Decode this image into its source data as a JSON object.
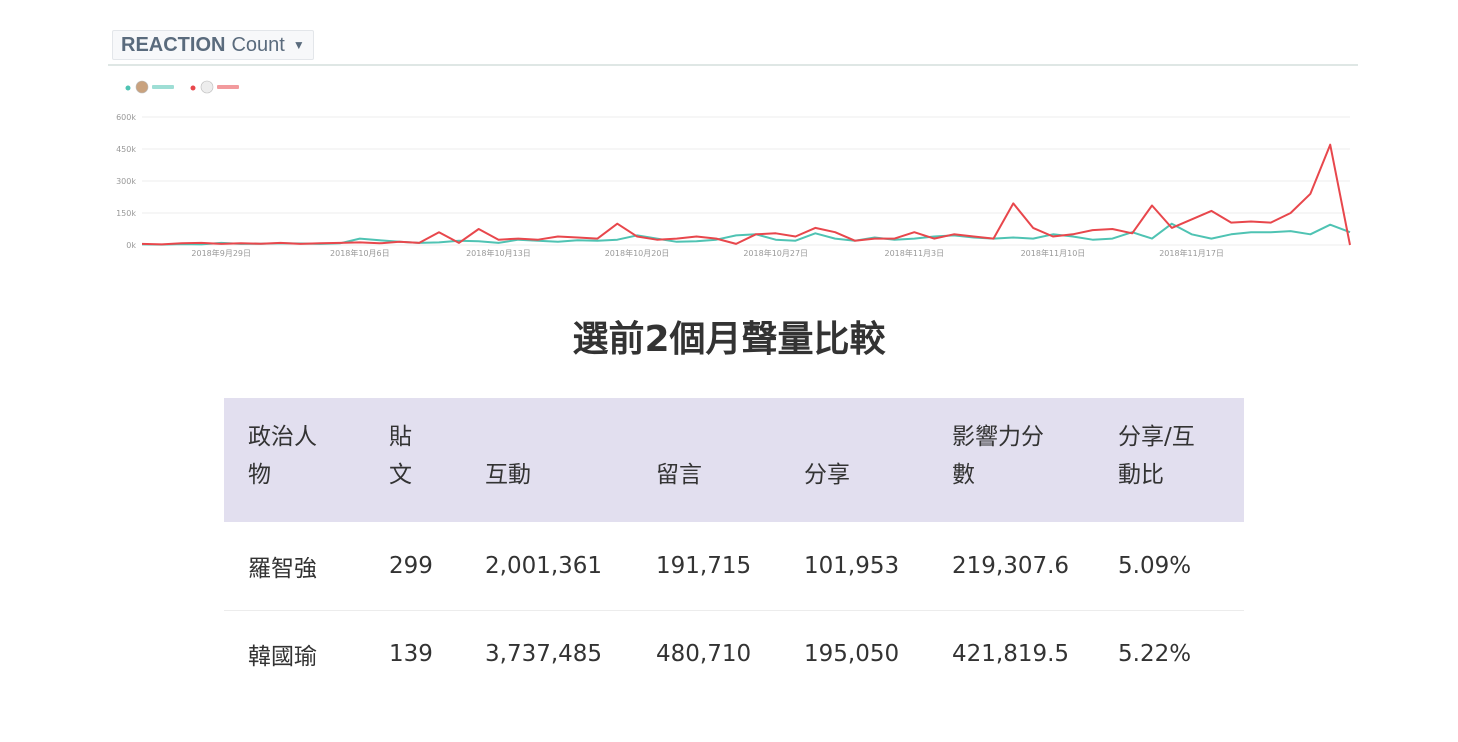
{
  "dropdown": {
    "bold": "REACTION",
    "rest": "Count",
    "caret_icon": "caret-down-icon"
  },
  "colors": {
    "series_1": "#4fc3b3",
    "series_2": "#e8474c",
    "grid": "#eeeeee",
    "axis_text": "#999999"
  },
  "chart_data": {
    "type": "line",
    "ylim": [
      0,
      600000
    ],
    "yticks": [
      0,
      150000,
      300000,
      450000,
      600000
    ],
    "ytick_labels": [
      "0k",
      "150k",
      "300k",
      "450k",
      "600k"
    ],
    "xticks": [
      4,
      11,
      18,
      25,
      32,
      39,
      46,
      53
    ],
    "xtick_labels": [
      "2018年9月29日",
      "2018年10月6日",
      "2018年10月13日",
      "2018年10月20日",
      "2018年10月27日",
      "2018年11月3日",
      "2018年11月10日",
      "2018年11月17日"
    ],
    "x": [
      0,
      1,
      2,
      3,
      4,
      5,
      6,
      7,
      8,
      9,
      10,
      11,
      12,
      13,
      14,
      15,
      16,
      17,
      18,
      19,
      20,
      21,
      22,
      23,
      24,
      25,
      26,
      27,
      28,
      29,
      30,
      31,
      32,
      33,
      34,
      35,
      36,
      37,
      38,
      39,
      40,
      41,
      42,
      43,
      44,
      45,
      46,
      47,
      48,
      49,
      50,
      51,
      52,
      53,
      54,
      55,
      56,
      57,
      58,
      59,
      60,
      61
    ],
    "series": [
      {
        "values": [
          3000,
          2000,
          4000,
          3000,
          10000,
          5000,
          6000,
          8000,
          7000,
          5000,
          8000,
          30000,
          22000,
          15000,
          10000,
          12000,
          20000,
          18000,
          10000,
          25000,
          20000,
          15000,
          22000,
          20000,
          25000,
          45000,
          30000,
          15000,
          18000,
          25000,
          45000,
          50000,
          25000,
          20000,
          55000,
          30000,
          20000,
          35000,
          25000,
          30000,
          40000,
          45000,
          35000,
          30000,
          35000,
          30000,
          50000,
          40000,
          25000,
          30000,
          60000,
          30000,
          100000,
          50000,
          30000,
          50000,
          60000,
          60000,
          65000,
          50000,
          95000,
          60000
        ]
      },
      {
        "values": [
          5000,
          3000,
          8000,
          10000,
          5000,
          8000,
          6000,
          10000,
          5000,
          8000,
          10000,
          12000,
          8000,
          15000,
          10000,
          60000,
          10000,
          75000,
          25000,
          30000,
          25000,
          40000,
          35000,
          30000,
          100000,
          40000,
          25000,
          30000,
          40000,
          30000,
          5000,
          50000,
          55000,
          40000,
          80000,
          60000,
          20000,
          30000,
          30000,
          60000,
          30000,
          50000,
          40000,
          30000,
          195000,
          80000,
          40000,
          50000,
          70000,
          75000,
          55000,
          185000,
          80000,
          120000,
          160000,
          105000,
          110000,
          105000,
          150000,
          240000,
          470000,
          0
        ]
      }
    ]
  },
  "title": "選前2個月聲量比較",
  "table": {
    "headers": [
      [
        "政治人",
        "物"
      ],
      [
        "貼",
        "文"
      ],
      [
        "",
        "互動"
      ],
      [
        "",
        "留言"
      ],
      [
        "",
        "分享"
      ],
      [
        "影響力分",
        "數"
      ],
      [
        "分享/互",
        "動比"
      ]
    ],
    "rows": [
      [
        "羅智強",
        "299",
        "2,001,361",
        "191,715",
        "101,953",
        "219,307.6",
        "5.09%"
      ],
      [
        "韓國瑜",
        "139",
        "3,737,485",
        "480,710",
        "195,050",
        "421,819.5",
        "5.22%"
      ]
    ]
  }
}
